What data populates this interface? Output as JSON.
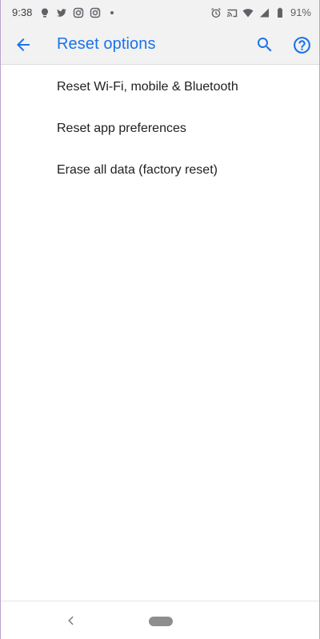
{
  "status_bar": {
    "time": "9:38",
    "left_icons": [
      "bulb-icon",
      "twitter-icon",
      "instagram-icon",
      "instagram-icon",
      "dot-icon"
    ],
    "right_icons": [
      "alarm-icon",
      "cast-icon",
      "wifi-icon",
      "signal-icon",
      "battery-icon"
    ],
    "battery_percent": "91%"
  },
  "app_bar": {
    "title": "Reset options",
    "accent_color": "#1a73e8"
  },
  "options": [
    {
      "label": "Reset Wi-Fi, mobile & Bluetooth"
    },
    {
      "label": "Reset app preferences"
    },
    {
      "label": "Erase all data (factory reset)"
    }
  ]
}
